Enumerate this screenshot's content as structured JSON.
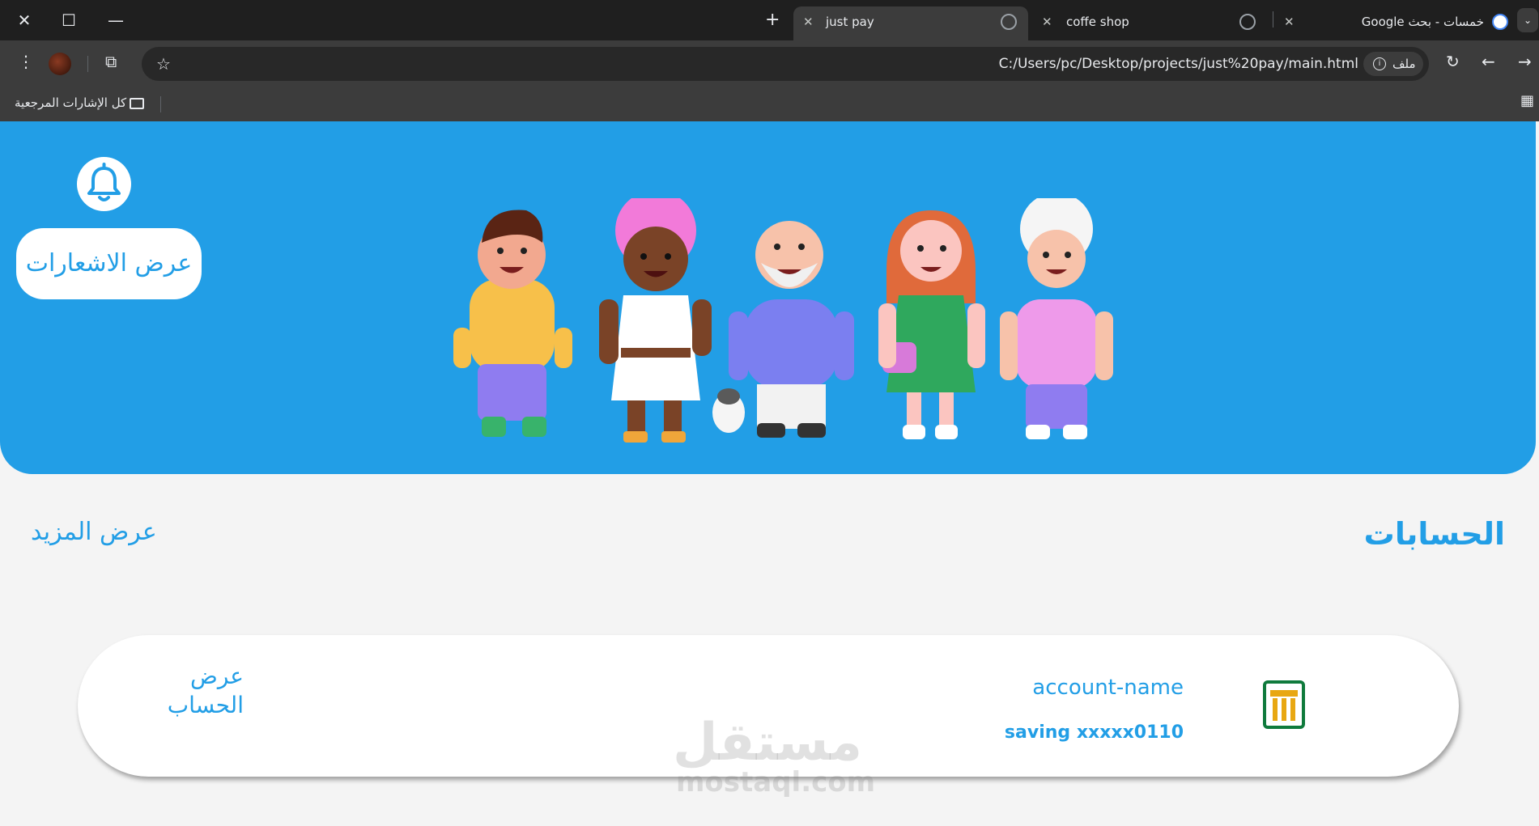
{
  "browser": {
    "tabs": [
      {
        "title": "just pay",
        "active": true
      },
      {
        "title": "coffe shop",
        "active": false
      },
      {
        "title": "خمسات - بحث Google",
        "active": false
      }
    ],
    "url": "C:/Users/pc/Desktop/projects/just%20pay/main.html",
    "security_chip": "ملف",
    "bookmarks_label": "كل الإشارات المرجعية"
  },
  "hero": {
    "notifications_button": "عرض الاشعارات",
    "background_color": "#229ee6"
  },
  "accounts": {
    "title": "الحسابات",
    "view_more": "عرض المزيد",
    "items": [
      {
        "name": "account-name",
        "number": "saving xxxxx0110",
        "view_label": "عرض الحساب"
      }
    ]
  },
  "watermark": {
    "arabic": "مستقل",
    "latin": "mostaql.com"
  }
}
